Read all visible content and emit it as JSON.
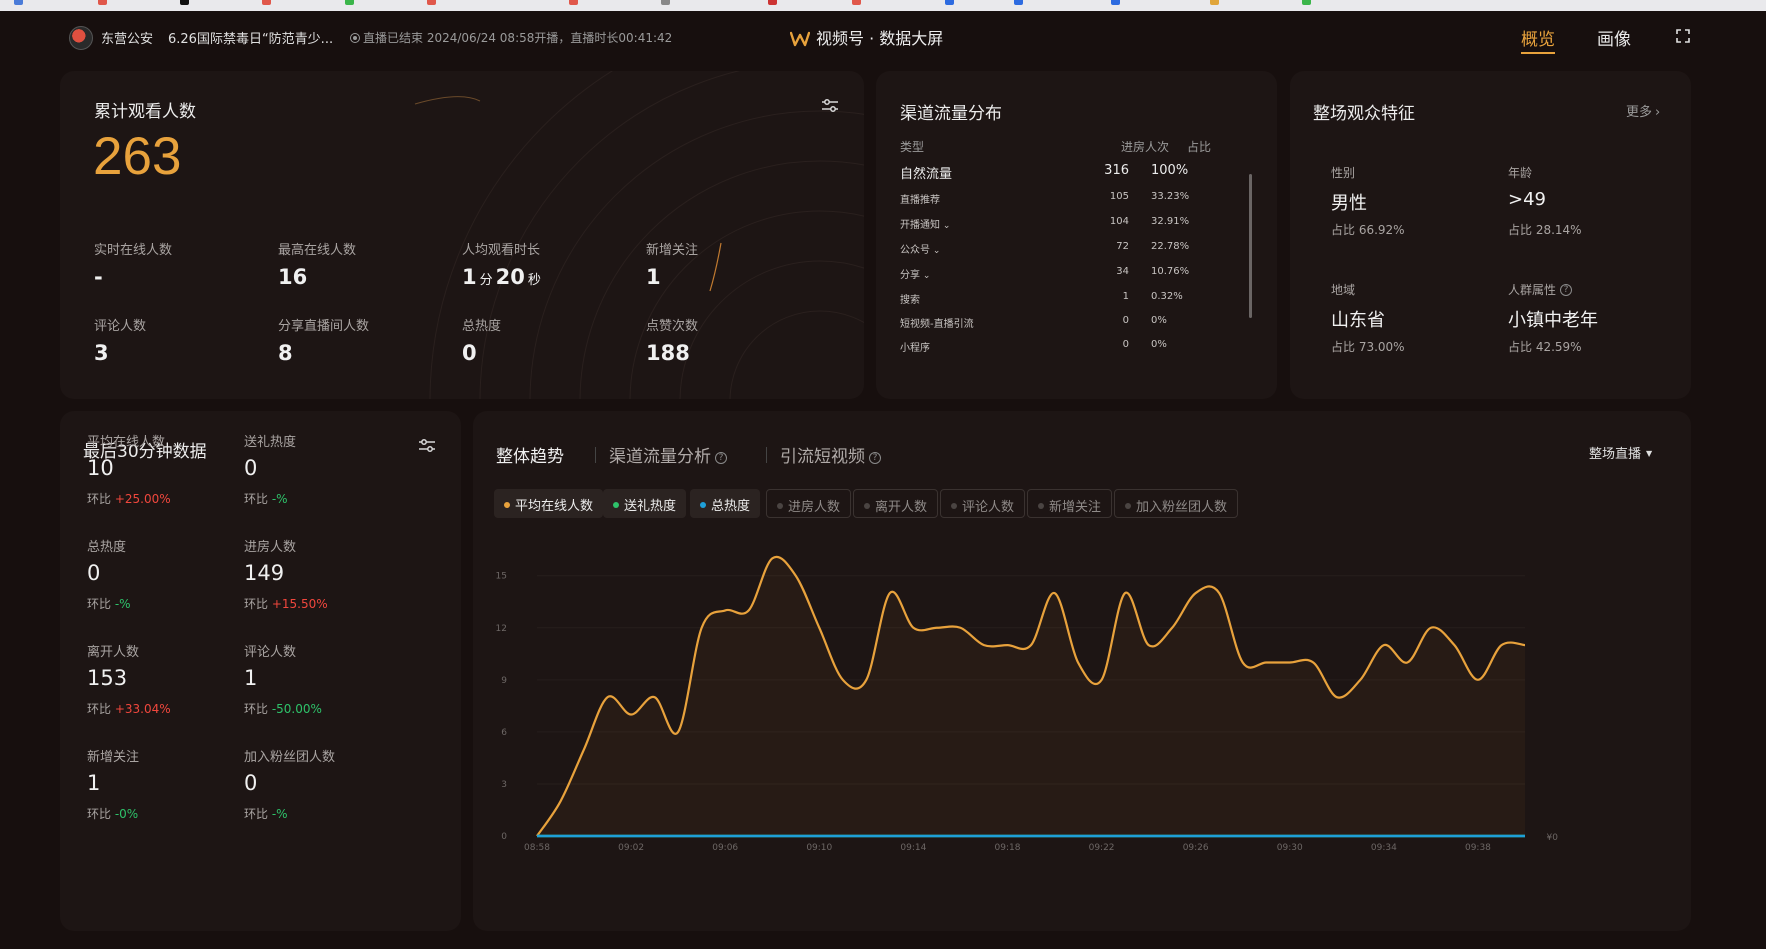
{
  "colors": {
    "accent": "#e8a23c",
    "line_orange": "#e8a23c",
    "line_green": "#2ec26a",
    "line_blue": "#1e9fd8",
    "up_red": "#f0473d",
    "down_green": "#2ec26a"
  },
  "header": {
    "anchor": "东营公安",
    "live_title": "6.26国际禁毒日“防范青少...",
    "status": "直播已结束 2024/06/24 08:58开播，直播时长00:41:42",
    "brand": "视频号 · 数据大屏",
    "tabs": [
      {
        "label": "概览",
        "active": true
      },
      {
        "label": "画像",
        "active": false
      }
    ],
    "fullscreen_icon": "fullscreen-icon"
  },
  "summary": {
    "title": "累计观看人数",
    "total": "263",
    "filter_icon": "sliders-icon",
    "metrics": [
      {
        "label": "实时在线人数",
        "value": "-"
      },
      {
        "label": "最高在线人数",
        "value": "16"
      },
      {
        "label": "人均观看时长",
        "value_min": "1",
        "unit_min": "分",
        "value_sec": "20",
        "unit_sec": "秒"
      },
      {
        "label": "新增关注",
        "value": "1"
      },
      {
        "label": "评论人数",
        "value": "3"
      },
      {
        "label": "分享直播间人数",
        "value": "8"
      },
      {
        "label": "总热度",
        "value": "0"
      },
      {
        "label": "点赞次数",
        "value": "188"
      }
    ]
  },
  "channels": {
    "title": "渠道流量分布",
    "headers": {
      "type": "类型",
      "count": "进房人次",
      "share": "占比"
    },
    "rows": [
      {
        "name": "自然流量",
        "count": "316",
        "share": "100%",
        "expand": false
      },
      {
        "name": "直播推荐",
        "count": "105",
        "share": "33.23%",
        "expand": false
      },
      {
        "name": "开播通知",
        "count": "104",
        "share": "32.91%",
        "expand": true
      },
      {
        "name": "公众号",
        "count": "72",
        "share": "22.78%",
        "expand": true
      },
      {
        "name": "分享",
        "count": "34",
        "share": "10.76%",
        "expand": true
      },
      {
        "name": "搜索",
        "count": "1",
        "share": "0.32%",
        "expand": false
      },
      {
        "name": "短视频-直播引流",
        "count": "0",
        "share": "0%",
        "expand": false
      },
      {
        "name": "小程序",
        "count": "0",
        "share": "0%",
        "expand": false
      }
    ]
  },
  "audience": {
    "title": "整场观众特征",
    "more": "更多",
    "items": [
      {
        "label": "性别",
        "value": "男性",
        "sub": "占比 66.92%"
      },
      {
        "label": "年龄",
        "value": ">49",
        "sub": "占比 28.14%"
      },
      {
        "label": "地域",
        "value": "山东省",
        "sub": "占比 73.00%"
      },
      {
        "label": "人群属性",
        "value": "小镇中老年",
        "sub": "占比 42.59%"
      }
    ]
  },
  "last30": {
    "title": "最后30分钟数据",
    "cmp_label": "环比",
    "items": [
      {
        "label": "平均在线人数",
        "value": "10",
        "cmp": "+25.00%",
        "dir": "up"
      },
      {
        "label": "送礼热度",
        "value": "0",
        "cmp": "-%",
        "dir": "down"
      },
      {
        "label": "总热度",
        "value": "0",
        "cmp": "-%",
        "dir": "down"
      },
      {
        "label": "进房人数",
        "value": "149",
        "cmp": "+15.50%",
        "dir": "up"
      },
      {
        "label": "离开人数",
        "value": "153",
        "cmp": "+33.04%",
        "dir": "up"
      },
      {
        "label": "评论人数",
        "value": "1",
        "cmp": "-50.00%",
        "dir": "down"
      },
      {
        "label": "新增关注",
        "value": "1",
        "cmp": "-0%",
        "dir": "down"
      },
      {
        "label": "加入粉丝团人数",
        "value": "0",
        "cmp": "-%",
        "dir": "down"
      }
    ]
  },
  "trend": {
    "tabs": [
      {
        "label": "整体趋势",
        "active": true,
        "help": false
      },
      {
        "label": "渠道流量分析",
        "active": false,
        "help": true
      },
      {
        "label": "引流短视频",
        "active": false,
        "help": true
      }
    ],
    "scope": "整场直播",
    "chips": [
      {
        "label": "平均在线人数",
        "on": true,
        "color": "#e8a23c"
      },
      {
        "label": "送礼热度",
        "on": true,
        "color": "#2ec26a"
      },
      {
        "label": "总热度",
        "on": true,
        "color": "#1e9fd8"
      },
      {
        "label": "进房人数",
        "on": false
      },
      {
        "label": "离开人数",
        "on": false
      },
      {
        "label": "评论人数",
        "on": false
      },
      {
        "label": "新增关注",
        "on": false
      },
      {
        "label": "加入粉丝团人数",
        "on": false
      }
    ]
  },
  "chart_data": {
    "type": "line",
    "x": [
      "08:58",
      "08:59",
      "09:00",
      "09:01",
      "09:02",
      "09:03",
      "09:04",
      "09:05",
      "09:06",
      "09:07",
      "09:08",
      "09:09",
      "09:10",
      "09:11",
      "09:12",
      "09:13",
      "09:14",
      "09:15",
      "09:16",
      "09:17",
      "09:18",
      "09:19",
      "09:20",
      "09:21",
      "09:22",
      "09:23",
      "09:24",
      "09:25",
      "09:26",
      "09:27",
      "09:28",
      "09:29",
      "09:30",
      "09:31",
      "09:32",
      "09:33",
      "09:34",
      "09:35",
      "09:36",
      "09:37",
      "09:38",
      "09:39",
      "09:40"
    ],
    "xticks": [
      "08:58",
      "09:02",
      "09:06",
      "09:10",
      "09:14",
      "09:18",
      "09:22",
      "09:26",
      "09:30",
      "09:34",
      "09:38"
    ],
    "yticks": [
      "0",
      "3",
      "6",
      "9",
      "12",
      "15"
    ],
    "ylim": [
      0,
      17
    ],
    "right_axis_label": "¥0",
    "series": [
      {
        "name": "平均在线人数",
        "color": "#e8a23c",
        "values": [
          0,
          2,
          5,
          8,
          7,
          8,
          6,
          12,
          13,
          13,
          16,
          15,
          12,
          9,
          9,
          14,
          12,
          12,
          12,
          11,
          11,
          11,
          14,
          10,
          9,
          14,
          11,
          12,
          14,
          14,
          10,
          10,
          10,
          10,
          8,
          9,
          11,
          10,
          12,
          11,
          9,
          11,
          11
        ]
      },
      {
        "name": "送礼热度",
        "color": "#2ec26a",
        "values": [
          0,
          0,
          0,
          0,
          0,
          0,
          0,
          0,
          0,
          0,
          0,
          0,
          0,
          0,
          0,
          0,
          0,
          0,
          0,
          0,
          0,
          0,
          0,
          0,
          0,
          0,
          0,
          0,
          0,
          0,
          0,
          0,
          0,
          0,
          0,
          0,
          0,
          0,
          0,
          0,
          0,
          0,
          0
        ]
      },
      {
        "name": "总热度",
        "color": "#1e9fd8",
        "values": [
          0,
          0,
          0,
          0,
          0,
          0,
          0,
          0,
          0,
          0,
          0,
          0,
          0,
          0,
          0,
          0,
          0,
          0,
          0,
          0,
          0,
          0,
          0,
          0,
          0,
          0,
          0,
          0,
          0,
          0,
          0,
          0,
          0,
          0,
          0,
          0,
          0,
          0,
          0,
          0,
          0,
          0,
          0
        ]
      }
    ]
  }
}
